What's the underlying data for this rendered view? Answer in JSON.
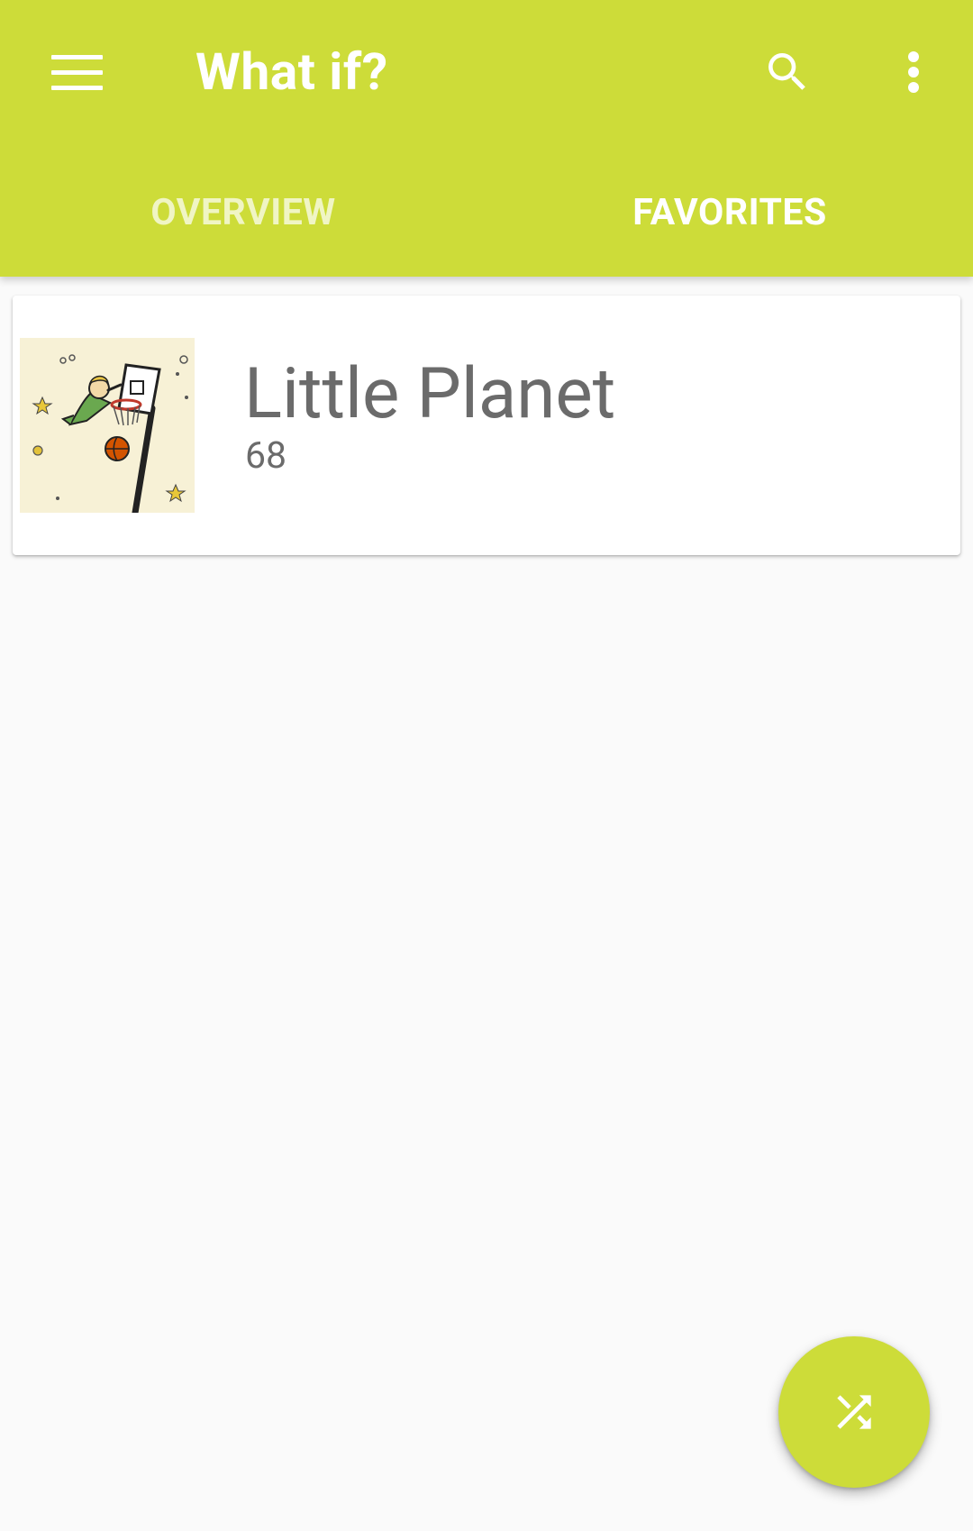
{
  "app_bar": {
    "title": "What if?",
    "background_color": "#cddc39",
    "menu_icon": "hamburger-menu-icon",
    "search_icon": "search-icon",
    "more_icon": "more-vert-icon"
  },
  "tabs": [
    {
      "label": "OVERVIEW",
      "selected": false
    },
    {
      "label": "FAVORITES",
      "selected": true
    }
  ],
  "favorites": [
    {
      "title": "Little Planet",
      "number": "68",
      "thumbnail": "little-prince-basketball-illustration"
    }
  ],
  "fab": {
    "icon": "shuffle-icon",
    "color": "#cddc39"
  }
}
